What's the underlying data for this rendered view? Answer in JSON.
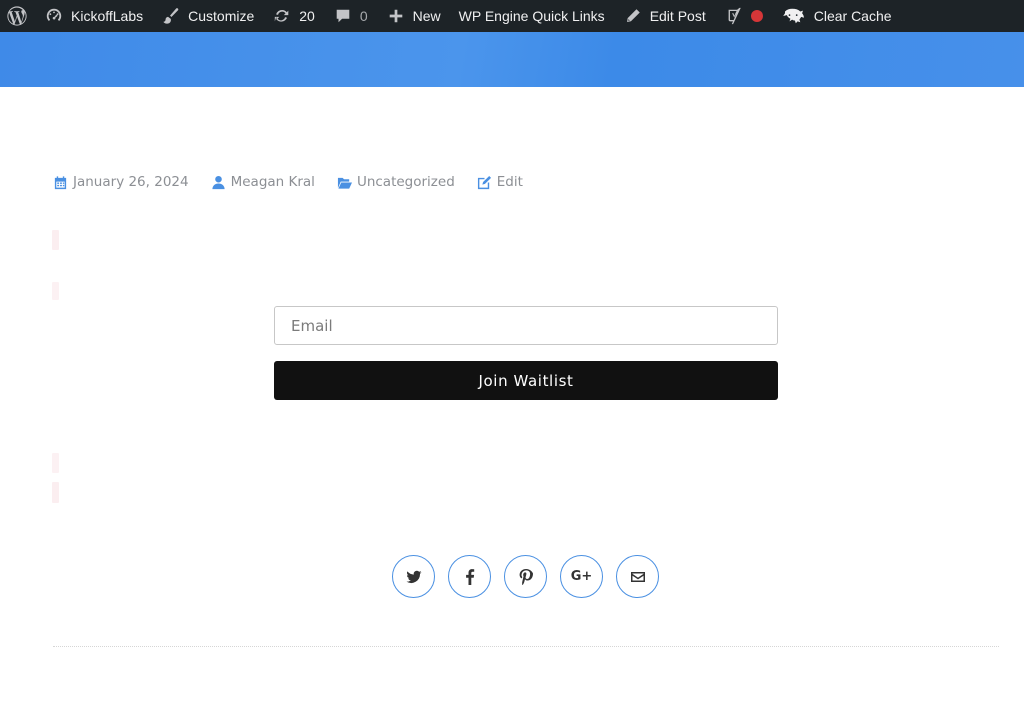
{
  "admin_bar": {
    "site_name": "KickoffLabs",
    "customize": "Customize",
    "updates_count": "20",
    "comments_count": "0",
    "new": "New",
    "wp_engine": "WP Engine Quick Links",
    "edit_post": "Edit Post",
    "clear_cache": "Clear Cache",
    "status_color": "#d63638"
  },
  "header": {
    "color": "#4a90e2"
  },
  "post_meta": {
    "date": "January 26, 2024",
    "author": "Meagan Kral",
    "category": "Uncategorized",
    "edit": "Edit",
    "icon_color": "#4a90e2"
  },
  "form": {
    "email_placeholder": "Email",
    "email_value": "",
    "submit_label": "Join Waitlist",
    "button_color": "#111111"
  },
  "share": {
    "icons": [
      "twitter-icon",
      "facebook-icon",
      "pinterest-icon",
      "google-plus-icon",
      "envelope-icon"
    ],
    "google_plus_text": "G+",
    "border_color": "#4a90e2"
  }
}
